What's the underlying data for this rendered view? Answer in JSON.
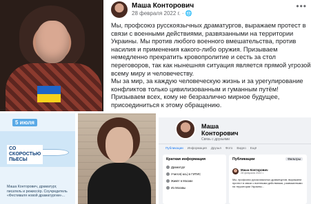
{
  "post": {
    "author": "Маша Конторович",
    "meta": "28 февраля 2022 г. · ",
    "more_icon": "ellipsis-icon",
    "paragraphs": [
      "Мы, профсоюз русскоязычных драматургов, выражаем протест в связи с военными действиями, развязанными на территории Украины. Мы против любого военного вмешательства, против насилия и применения какого-либо оружия. Призываем немедленно прекратить кровопролитие и сесть за стол переговоров, так как нынешняя ситуация является прямой угрозой всему миру и человечеству.",
      "Мы за мир, за каждую человеческую жизнь и за урегулирование конфликтов только цивилизованным и гуманным путём! Призываем всех, кому не безразлично мирное будущее, присоединиться к этому обращению."
    ]
  },
  "flag": {
    "top": "#1f66c8",
    "bottom": "#f7d21c"
  },
  "card": {
    "date": "5 июля",
    "title_lines": [
      "СО",
      "СКОРОСТЬЮ",
      "ПЬЕСЫ"
    ],
    "caption": "Маша Конторович, драматург, писатель и режиссёр. Соучредитель «Фестиваля новой драматургии»..."
  },
  "profile": {
    "name_lines": [
      "Маша",
      "Конторович"
    ],
    "friends": "Связь с друзьями",
    "tabs": [
      "Публикации",
      "Информация",
      "Друзья",
      "Фото",
      "Видео",
      "Ещё"
    ],
    "intro_title": "Краткая информация",
    "intro_rows": [
      "Драматург",
      "Учился(-ась) в ГИТИС",
      "Живёт в Москве",
      "Из Москвы"
    ],
    "posts_title": "Публикации",
    "filters_label": "Фильтры",
    "post_author": "Маша Конторович",
    "post_date": "28 февраля 2022 г.",
    "post_text": "Мы, профсоюз русскоязычных драматургов, выражаем протест в связи с военными действиями, развязанными на территории Украины..."
  }
}
